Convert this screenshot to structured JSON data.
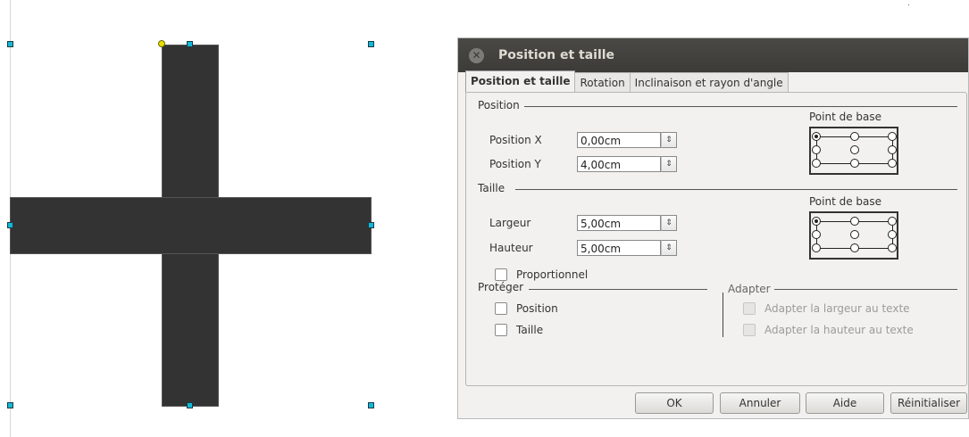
{
  "dialog": {
    "title": "Position et taille",
    "tabs": [
      {
        "label": "Position et taille",
        "active": true
      },
      {
        "label": "Rotation",
        "active": false
      },
      {
        "label": "Inclinaison et rayon d'angle",
        "active": false
      }
    ],
    "position": {
      "section_label": "Position",
      "x_label": "Position X",
      "x_value": "0,00cm",
      "y_label": "Position Y",
      "y_value": "4,00cm",
      "base_point_label": "Point de base"
    },
    "size": {
      "section_label": "Taille",
      "width_label": "Largeur",
      "width_value": "5,00cm",
      "height_label": "Hauteur",
      "height_value": "5,00cm",
      "base_point_label": "Point de base",
      "proportional_label": "Proportionnel",
      "proportional_checked": false
    },
    "protect": {
      "section_label": "Protéger",
      "position_label": "Position",
      "size_label": "Taille"
    },
    "adapt": {
      "section_label": "Adapter",
      "fit_width_label": "Adapter la largeur au texte",
      "fit_height_label": "Adapter la hauteur au texte"
    },
    "buttons": {
      "ok": "OK",
      "cancel": "Annuler",
      "help": "Aide",
      "reset": "Réinitialiser"
    },
    "spin_glyph": "⇕",
    "close_glyph": "✕"
  },
  "colors": {
    "shape_fill": "#333333",
    "handle": "#13b8d8",
    "titlebar": "#3c3b37"
  }
}
